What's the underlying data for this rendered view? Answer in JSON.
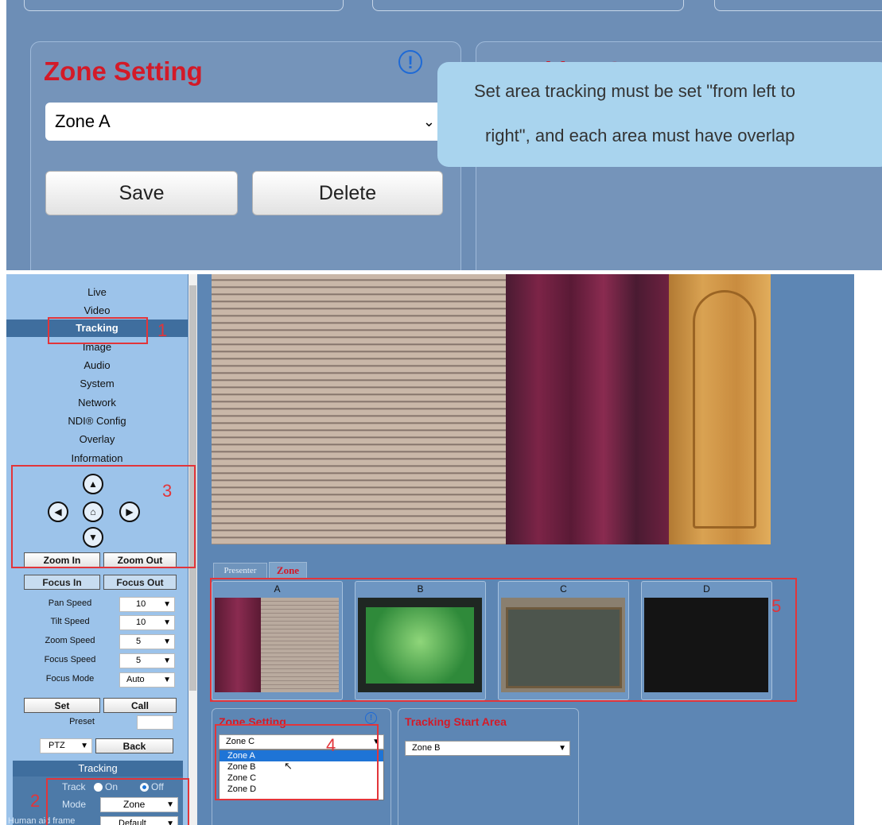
{
  "top": {
    "zone_setting_title": "Zone Setting",
    "zone_select_value": "Zone A",
    "save_label": "Save",
    "delete_label": "Delete",
    "tooltip_line1": "Set area tracking must be set \"from left to",
    "tooltip_line2": "right\", and each area must have overlap",
    "info_icon": "(!)",
    "partial_title": "Tracking Start Area"
  },
  "sidebar": {
    "nav": [
      "Live",
      "Video",
      "Tracking",
      "Image",
      "Audio",
      "System",
      "Network",
      "NDI® Config",
      "Overlay",
      "Information"
    ],
    "active_index": 2,
    "zoom_in": "Zoom In",
    "zoom_out": "Zoom Out",
    "focus_in": "Focus In",
    "focus_out": "Focus Out",
    "speeds": [
      {
        "label": "Pan Speed",
        "value": "10"
      },
      {
        "label": "Tilt Speed",
        "value": "10"
      },
      {
        "label": "Zoom Speed",
        "value": "5"
      },
      {
        "label": "Focus Speed",
        "value": "5"
      },
      {
        "label": "Focus Mode",
        "value": "Auto"
      }
    ],
    "set_label": "Set",
    "call_label": "Call",
    "preset_label": "Preset",
    "ptz_value": "PTZ",
    "back_label": "Back",
    "tracking_header": "Tracking",
    "track_label": "Track",
    "on_label": "On",
    "off_label": "Off",
    "track_selected": "Off",
    "mode_label": "Mode",
    "mode_value": "Zone",
    "cut_label": "Human aid frame",
    "cut_value": "Default"
  },
  "annotations": [
    "1",
    "2",
    "3",
    "4",
    "5"
  ],
  "tabs": [
    "Presenter",
    "Zone"
  ],
  "active_tab": "Zone",
  "zones": [
    "A",
    "B",
    "C",
    "D"
  ],
  "zone_setting": {
    "title": "Zone Setting",
    "select_value": "Zone C",
    "options": [
      "Zone A",
      "Zone B",
      "Zone C",
      "Zone D"
    ],
    "highlighted_option": "Zone A"
  },
  "tracking_start": {
    "title": "Tracking Start Area",
    "value": "Zone B"
  },
  "colors": {
    "accent_red": "#d31a28",
    "annotation_red": "#e2353a",
    "highlight_blue": "#1e74d6"
  }
}
